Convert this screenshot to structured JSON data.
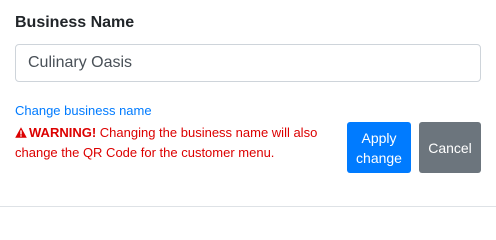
{
  "form": {
    "label": "Business Name",
    "input_value": "Culinary Oasis",
    "change_link": "Change business name",
    "warning": {
      "icon": "exclamation-triangle-icon",
      "strong": "WARNING!",
      "text": " Changing the business name will also change the QR Code for the customer menu."
    },
    "apply_line1": "Apply",
    "apply_line2": "change",
    "cancel": "Cancel"
  },
  "colors": {
    "primary": "#007bff",
    "secondary": "#6c757d",
    "danger": "#dc0000",
    "text": "#212529",
    "border": "#ced4da"
  }
}
